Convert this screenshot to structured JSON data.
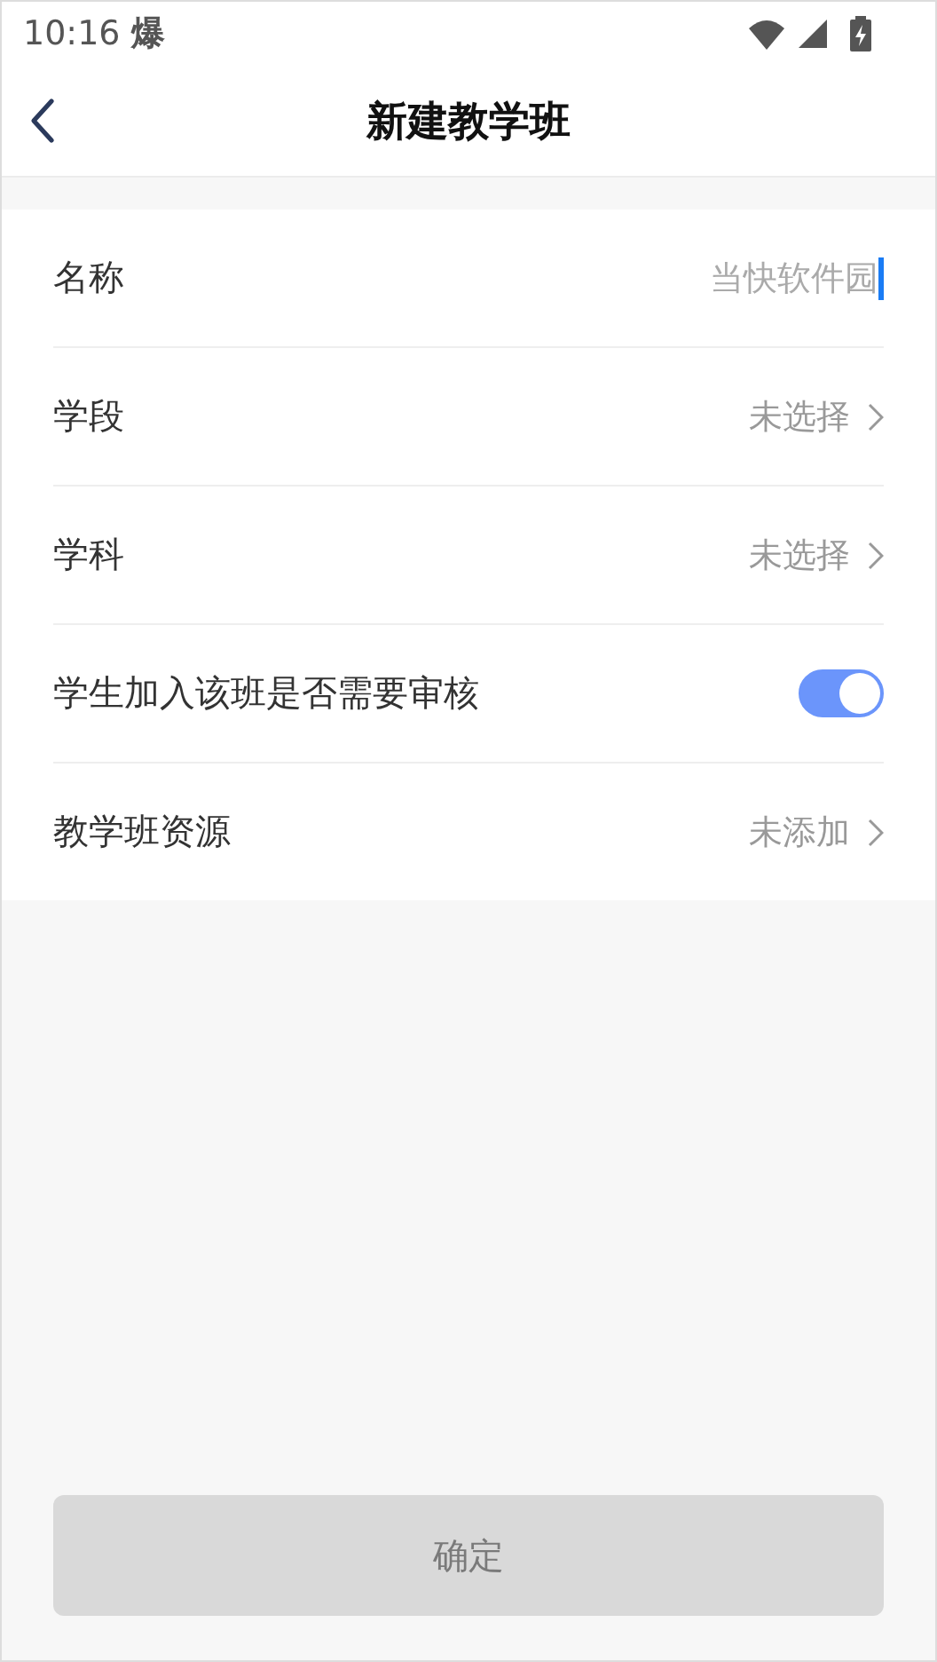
{
  "status_bar": {
    "time": "10:16",
    "notification": "爆"
  },
  "header": {
    "title": "新建教学班"
  },
  "rows": [
    {
      "kind": "input",
      "label": "名称",
      "value": "当快软件园"
    },
    {
      "kind": "select",
      "label": "学段",
      "value": "未选择"
    },
    {
      "kind": "select",
      "label": "学科",
      "value": "未选择"
    },
    {
      "kind": "toggle",
      "label": "学生加入该班是否需要审核",
      "on": true
    },
    {
      "kind": "select",
      "label": "教学班资源",
      "value": "未添加"
    }
  ],
  "confirm_button": {
    "label": "确定",
    "disabled": true
  }
}
